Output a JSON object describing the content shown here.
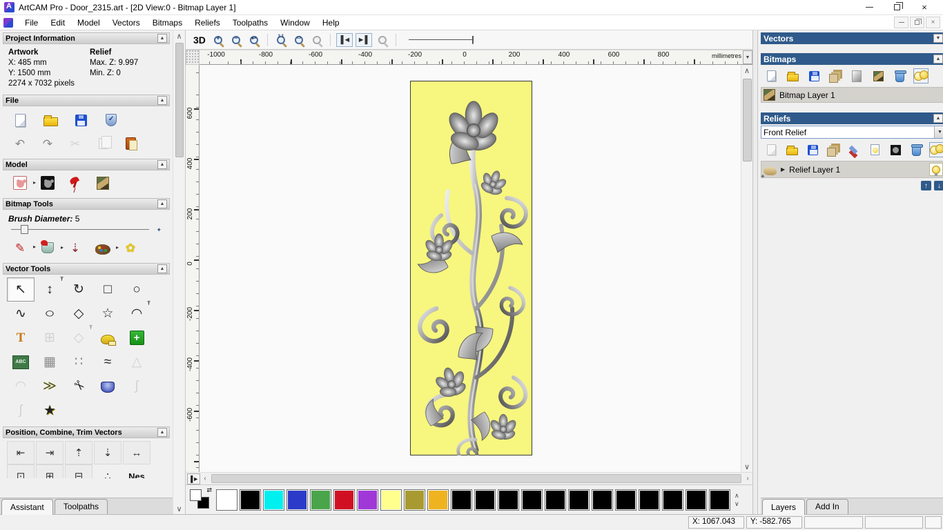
{
  "window": {
    "title": "ArtCAM Pro - Door_2315.art - [2D View:0 - Bitmap Layer 1]",
    "menus": [
      "File",
      "Edit",
      "Model",
      "Vectors",
      "Bitmaps",
      "Reliefs",
      "Toolpaths",
      "Window",
      "Help"
    ]
  },
  "assistant": {
    "tabs": [
      "Assistant",
      "Toolpaths"
    ],
    "project_information": {
      "title": "Project Information",
      "artwork_label": "Artwork",
      "relief_label": "Relief",
      "x": "X: 485 mm",
      "y": "Y: 1500 mm",
      "pixels": "2274 x 7032 pixels",
      "max_z": "Max. Z: 9.997",
      "min_z": "Min. Z: 0"
    },
    "file_section": {
      "title": "File"
    },
    "model_section": {
      "title": "Model"
    },
    "bitmap_tools": {
      "title": "Bitmap Tools",
      "brush_label": "Brush Diameter:",
      "brush_value": "5"
    },
    "vector_tools": {
      "title": "Vector Tools"
    },
    "position_section": {
      "title": "Position, Combine, Trim Vectors",
      "nesting_label": "Nes"
    }
  },
  "canvas": {
    "toolbar": {
      "view3d_label": "3D",
      "zoom_in": "+",
      "zoom_out": "−",
      "zoom_prev": "↩",
      "zoom_11": "1:1",
      "zoom_box": "▭",
      "zoom_obj": "●"
    },
    "ruler_units": "millimetres",
    "ruler_h_ticks": [
      "-1000",
      "-800",
      "-600",
      "-400",
      "-200",
      "0",
      "200",
      "400",
      "600",
      "800"
    ],
    "ruler_v_ticks": [
      "600",
      "400",
      "200",
      "0",
      "-200",
      "-400",
      "-600"
    ]
  },
  "right_panel": {
    "vectors": {
      "title": "Vectors"
    },
    "bitmaps": {
      "title": "Bitmaps",
      "layer_name": "Bitmap Layer 1"
    },
    "reliefs": {
      "title": "Reliefs",
      "selected_relief": "Front Relief",
      "layer_name": "Relief Layer 1"
    },
    "tabs": [
      "Layers",
      "Add In"
    ]
  },
  "palette": {
    "foreground": "#ffffff",
    "background": "#000000",
    "swatches": [
      "#ffffff",
      "#000000",
      "#00efef",
      "#2b3bc8",
      "#4aa54a",
      "#d01022",
      "#a038d8",
      "#ffff8e",
      "#a89a30",
      "#eeb31e",
      "#000000",
      "#000000",
      "#000000",
      "#000000",
      "#000000",
      "#000000",
      "#000000",
      "#000000",
      "#000000",
      "#000000",
      "#000000",
      "#000000"
    ]
  },
  "status_bar": {
    "x": "X: 1067.043",
    "y": "Y: -582.765"
  },
  "colors": {
    "header_blue": "#2f5a8b",
    "selection_gray": "#d4d2cd",
    "artwork_yellow": "#f7f67e"
  },
  "icons": {
    "undo": "↶",
    "redo": "↷",
    "cut": "✂",
    "select": "↖",
    "node_edit": "↕",
    "transform": "↻",
    "rectangle": "□",
    "circle": "○",
    "polyline": "∿",
    "ellipse": "○",
    "polygon": "◇",
    "star": "☆",
    "arc": "◠",
    "text_tool": "T",
    "block_copy": "⊞",
    "offset_shape": "◇",
    "abc_block": "ABC",
    "distort_grid": "▦",
    "paste_along": "∷",
    "fit_curve": "≈",
    "simplify": "△",
    "arc_edit": "◠",
    "offset_arrow": "≫",
    "trim": "✂",
    "extrude": "◉",
    "spline": "ʃ",
    "mirror_profile": "ʃ",
    "wrap_star": "★",
    "pencil": "✎",
    "dropper": "⇣",
    "reduce_colors": "✿",
    "align_left": "⇤",
    "align_right": "⇥",
    "align_top": "⇡",
    "align_bottom": "⇣",
    "align_center": "↔",
    "center_page": "⊡",
    "group": "⊞",
    "ungroup": "⊟",
    "dots": "∴"
  }
}
